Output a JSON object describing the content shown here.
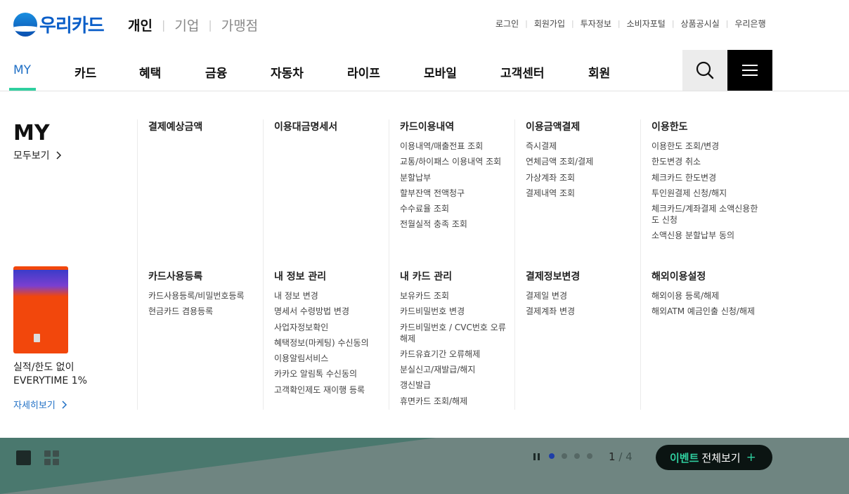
{
  "brand": {
    "logo_text": "우리카드"
  },
  "biz_nav": [
    {
      "label": "개인",
      "active": true
    },
    {
      "label": "기업",
      "active": false
    },
    {
      "label": "가맹점",
      "active": false
    }
  ],
  "util_nav": [
    "로그인",
    "회원가입",
    "투자정보",
    "소비자포털",
    "상품공시실",
    "우리은행"
  ],
  "gnb": [
    {
      "label": "MY",
      "active": true
    },
    {
      "label": "카드"
    },
    {
      "label": "혜택"
    },
    {
      "label": "금융"
    },
    {
      "label": "자동차"
    },
    {
      "label": "라이프"
    },
    {
      "label": "모바일"
    },
    {
      "label": "고객센터"
    },
    {
      "label": "회원"
    }
  ],
  "mega": {
    "title": "MY",
    "view_all": "모두보기",
    "card": {
      "desc_line1": "실적/한도 없이",
      "desc_line2": "EVERYTIME 1%",
      "more": "자세히보기"
    },
    "row1": [
      {
        "head": "결제예상금액",
        "items": []
      },
      {
        "head": "이용대금명세서",
        "items": []
      },
      {
        "head": "카드이용내역",
        "items": [
          "이용내역/매출전표 조회",
          "교통/하이패스 이용내역 조회",
          "분할납부",
          "할부잔액 전액청구",
          "수수료율 조회",
          "전월실적 충족 조회"
        ]
      },
      {
        "head": "이용금액결제",
        "items": [
          "즉시결제",
          "연체금액 조회/결제",
          "가상계좌 조회",
          "결제내역 조회"
        ]
      },
      {
        "head": "이용한도",
        "items": [
          "이용한도 조회/변경",
          "한도변경 취소",
          "체크카드 한도변경",
          "투인원결제 신청/해지",
          "체크카드/계좌결제 소액신용한도 신청",
          "소액신용 분할납부 동의"
        ]
      }
    ],
    "row2": [
      {
        "head": "카드사용등록",
        "items": [
          "카드사용등록/비밀번호등록",
          "현금카드 겸용등록"
        ]
      },
      {
        "head": "내 정보 관리",
        "items": [
          "내 정보 변경",
          "명세서 수령방법 변경",
          "사업자정보확인",
          "혜택정보(마케팅) 수신동의",
          "이용알림서비스",
          "카카오 알림톡 수신동의",
          "고객확인제도 재이행 등록"
        ]
      },
      {
        "head": "내 카드 관리",
        "items": [
          "보유카드 조회",
          "카드비밀번호 변경",
          "카드비밀번호 / CVC번호 오류해제",
          "카드유효기간 오류해제",
          "분실신고/재발급/해지",
          "갱신발급",
          "휴면카드 조회/해제"
        ]
      },
      {
        "head": "결제정보변경",
        "items": [
          "결제일 변경",
          "결제계좌 변경"
        ]
      },
      {
        "head": "해외이용설정",
        "items": [
          "해외이용 등록/해제",
          "해외ATM 예금인출 신청/해제"
        ]
      }
    ]
  },
  "banner": {
    "pager_current": "1",
    "pager_sep": " / ",
    "pager_total": "4",
    "event_em": "이벤트",
    "event_label": "전체보기",
    "event_plus": "+",
    "slides": 4,
    "active_slide": 1
  }
}
